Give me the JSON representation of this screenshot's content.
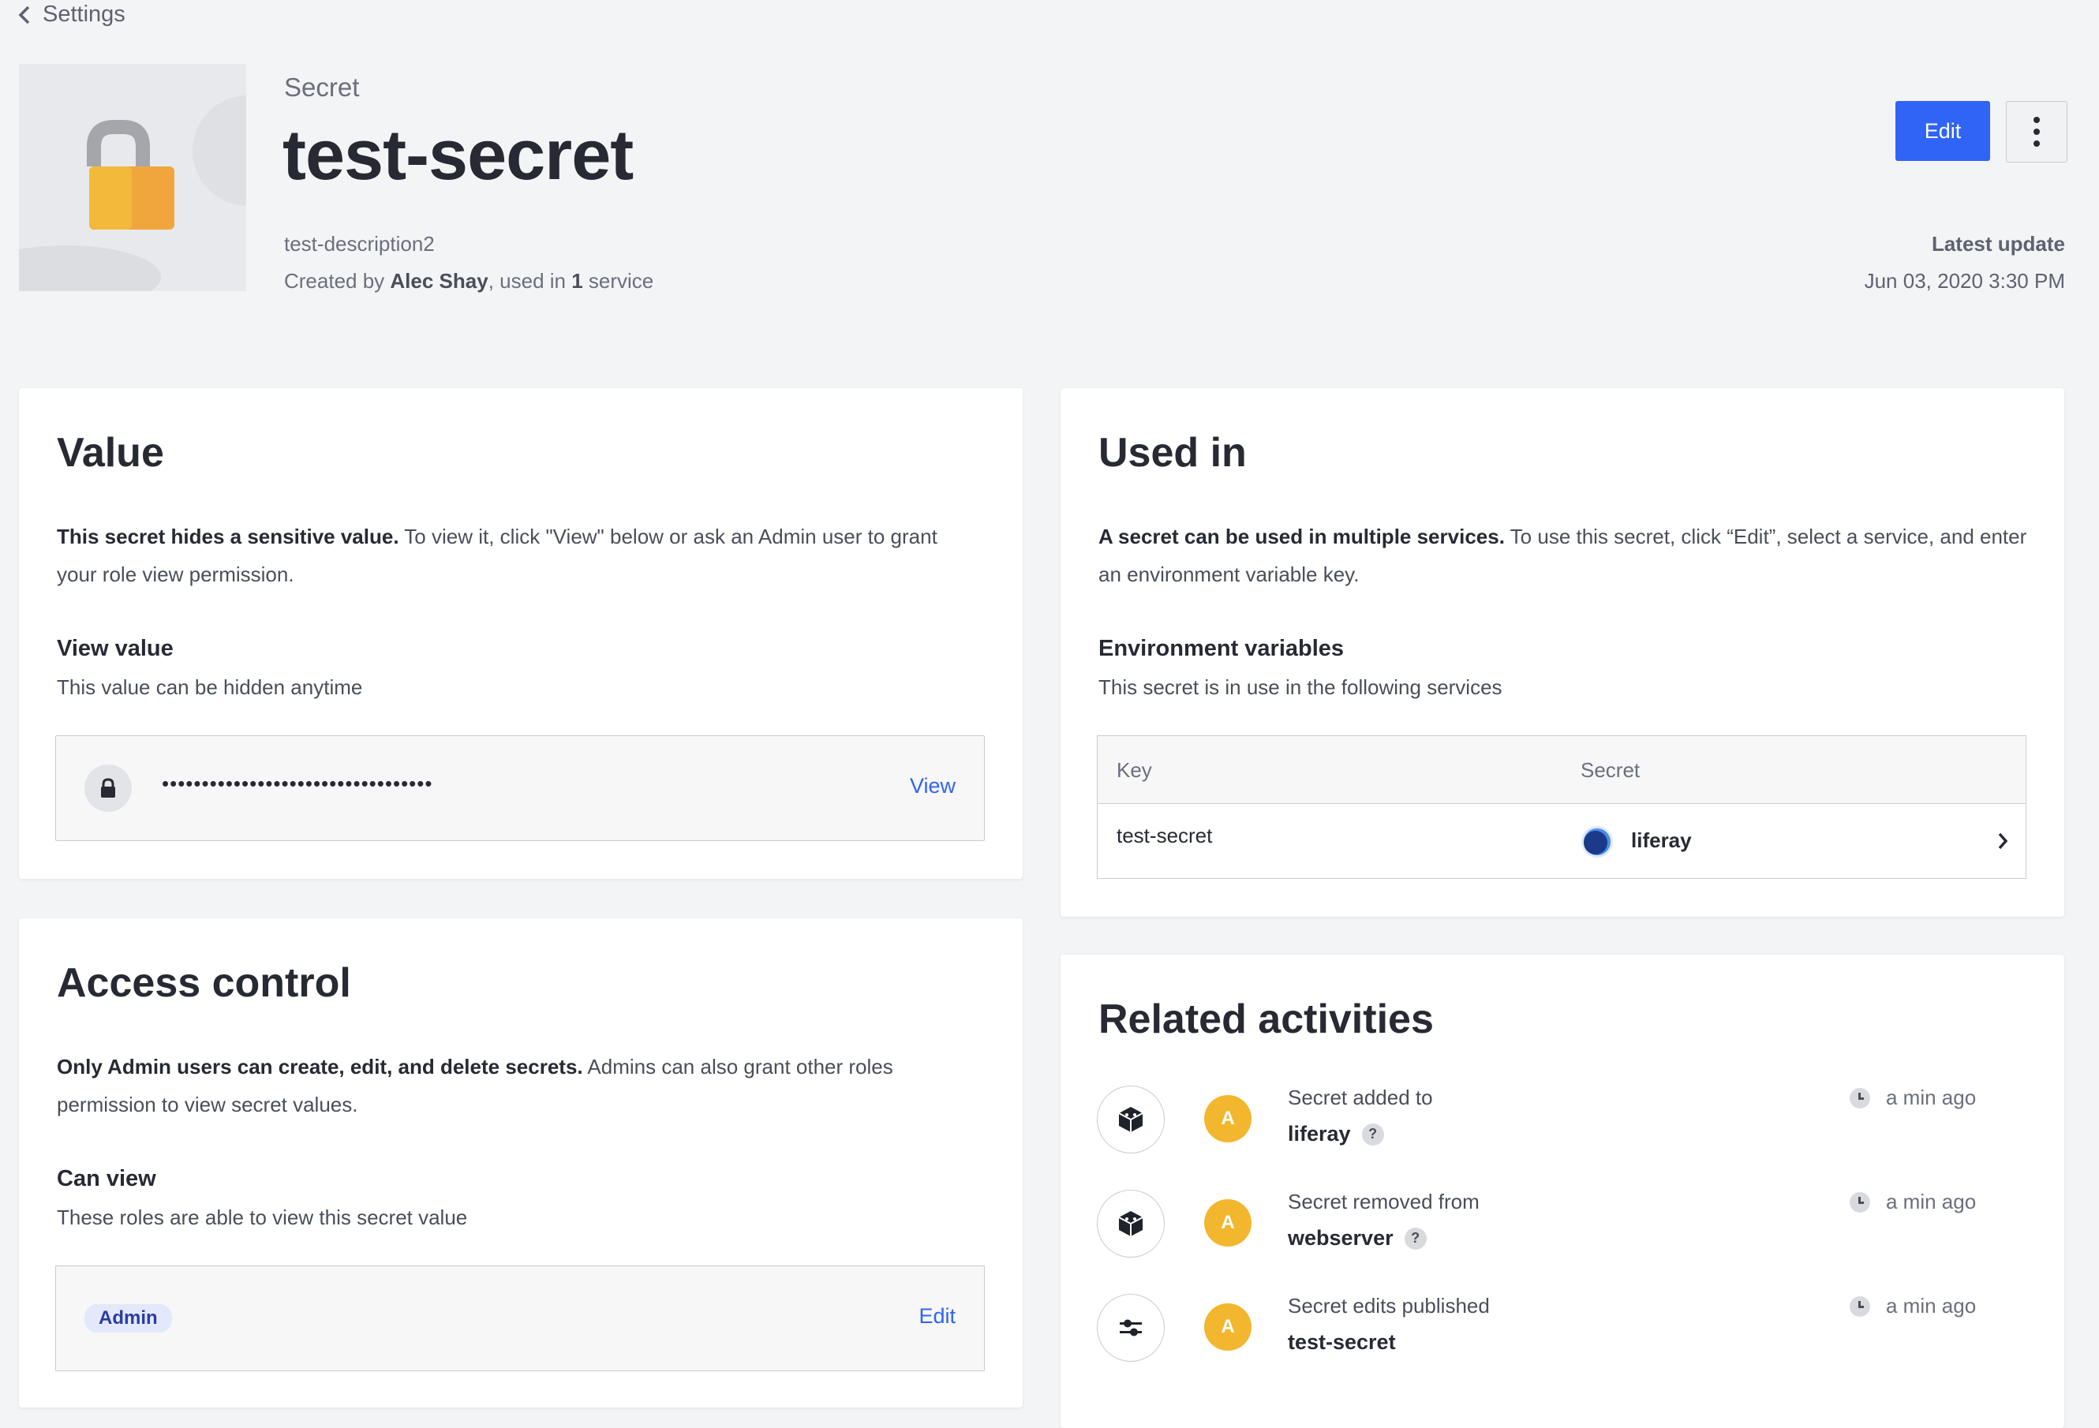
{
  "nav": {
    "back_label": "Settings"
  },
  "header": {
    "kicker": "Secret",
    "title": "test-secret",
    "description": "test-description2",
    "created_prefix": "Created by ",
    "created_user": "Alec Shay",
    "created_mid": ", used in ",
    "created_count": "1",
    "created_suffix": " service",
    "edit_label": "Edit",
    "latest_update_label": "Latest update",
    "latest_update_value": "Jun 03, 2020 3:30 PM"
  },
  "value_card": {
    "title": "Value",
    "intro_bold": "This secret hides a sensitive value.",
    "intro_rest": " To view it, click \"View\" below or ask an Admin user to grant your role view permission.",
    "view_value_heading": "View value",
    "view_value_sub": "This value can be hidden anytime",
    "masked_value": "••••••••••••••••••••••••••••••••••",
    "view_label": "View"
  },
  "access_card": {
    "title": "Access control",
    "intro_bold": "Only Admin users can create, edit, and delete secrets.",
    "intro_rest": " Admins can also grant other roles permission to view secret values.",
    "can_view_heading": "Can view",
    "can_view_sub": "These roles are able to view this secret value",
    "role_badge": "Admin",
    "edit_label": "Edit"
  },
  "used_in_card": {
    "title": "Used in",
    "intro_bold": "A secret can be used in multiple services.",
    "intro_rest": " To use this secret, click “Edit”, select a service, and enter an environment variable key.",
    "env_heading": "Environment variables",
    "env_sub": "This secret is in use in the following services",
    "table": {
      "col_key": "Key",
      "col_secret": "Secret",
      "rows": [
        {
          "key": "test-secret",
          "service": "liferay"
        }
      ]
    }
  },
  "activities_card": {
    "title": "Related activities",
    "items": [
      {
        "icon": "box-icon",
        "avatar": "A",
        "line1": "Secret added to",
        "line2": "liferay",
        "help": "?",
        "time": "a min ago"
      },
      {
        "icon": "box-icon",
        "avatar": "A",
        "line1": "Secret removed from",
        "line2": "webserver",
        "help": "?",
        "time": "a min ago"
      },
      {
        "icon": "sliders-icon",
        "avatar": "A",
        "line1": "Secret edits published",
        "line2": "test-secret",
        "time": "a min ago"
      }
    ]
  }
}
